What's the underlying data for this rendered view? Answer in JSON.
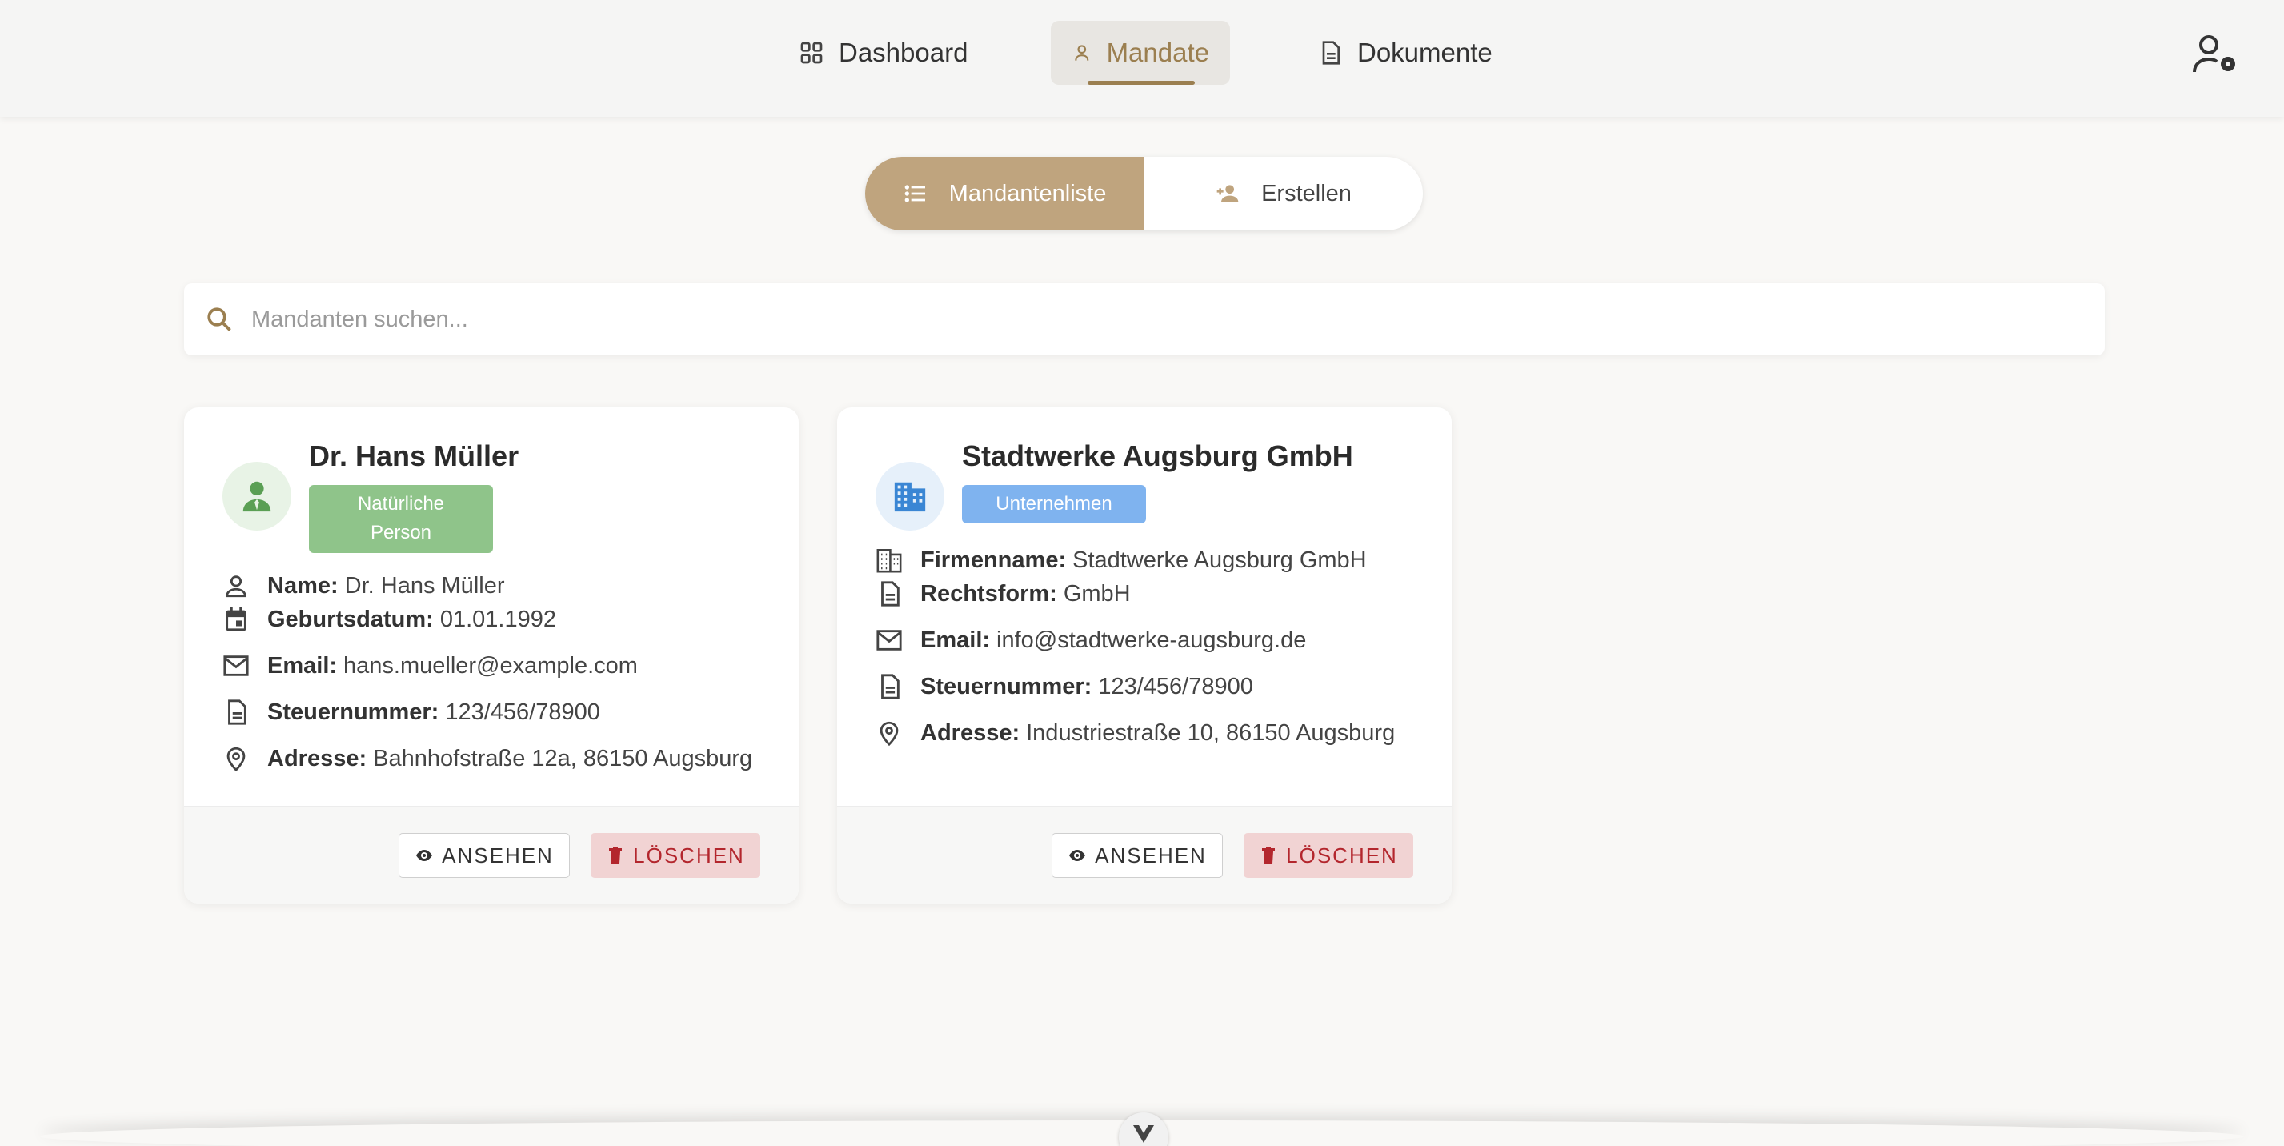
{
  "nav": {
    "dashboard": "Dashboard",
    "mandate": "Mandate",
    "dokumente": "Dokumente"
  },
  "segmented": {
    "list": "Mandantenliste",
    "create": "Erstellen"
  },
  "search": {
    "placeholder": "Mandanten suchen...",
    "value": ""
  },
  "colors": {
    "accent": "#9b7f50",
    "segment_active": "#bfa47e",
    "badge_person": "#8fc48a",
    "badge_company": "#7fb3ef",
    "delete": "#b3262d"
  },
  "clients": [
    {
      "name": "Dr. Hans Müller",
      "type_badge_line1": "Natürliche",
      "type_badge_line2": "Person",
      "icon": "person-tie-icon",
      "fields": [
        {
          "label": "Name:",
          "value": "Dr. Hans Müller",
          "icon": "person-icon"
        },
        {
          "label": "Geburtsdatum:",
          "value": "01.01.1992",
          "icon": "calendar-icon"
        },
        {
          "label": "Email:",
          "value": "hans.mueller@example.com",
          "icon": "mail-icon"
        },
        {
          "label": "Steuernummer:",
          "value": "123/456/78900",
          "icon": "document-icon"
        },
        {
          "label": "Adresse:",
          "value": "Bahnhofstraße 12a, 86150 Augsburg",
          "icon": "location-icon"
        }
      ],
      "view_label": "ANSEHEN",
      "delete_label": "LÖSCHEN"
    },
    {
      "name": "Stadtwerke Augsburg GmbH",
      "type_badge": "Unternehmen",
      "icon": "building-icon",
      "fields": [
        {
          "label": "Firmenname:",
          "value": "Stadtwerke Augsburg GmbH",
          "icon": "building-icon"
        },
        {
          "label": "Rechtsform:",
          "value": "GmbH",
          "icon": "document-icon"
        },
        {
          "label": "Email:",
          "value": "info@stadtwerke-augsburg.de",
          "icon": "mail-icon"
        },
        {
          "label": "Steuernummer:",
          "value": "123/456/78900",
          "icon": "document-icon"
        },
        {
          "label": "Adresse:",
          "value": "Industriestraße 10, 86150 Augsburg",
          "icon": "location-icon"
        }
      ],
      "view_label": "ANSEHEN",
      "delete_label": "LÖSCHEN"
    }
  ]
}
